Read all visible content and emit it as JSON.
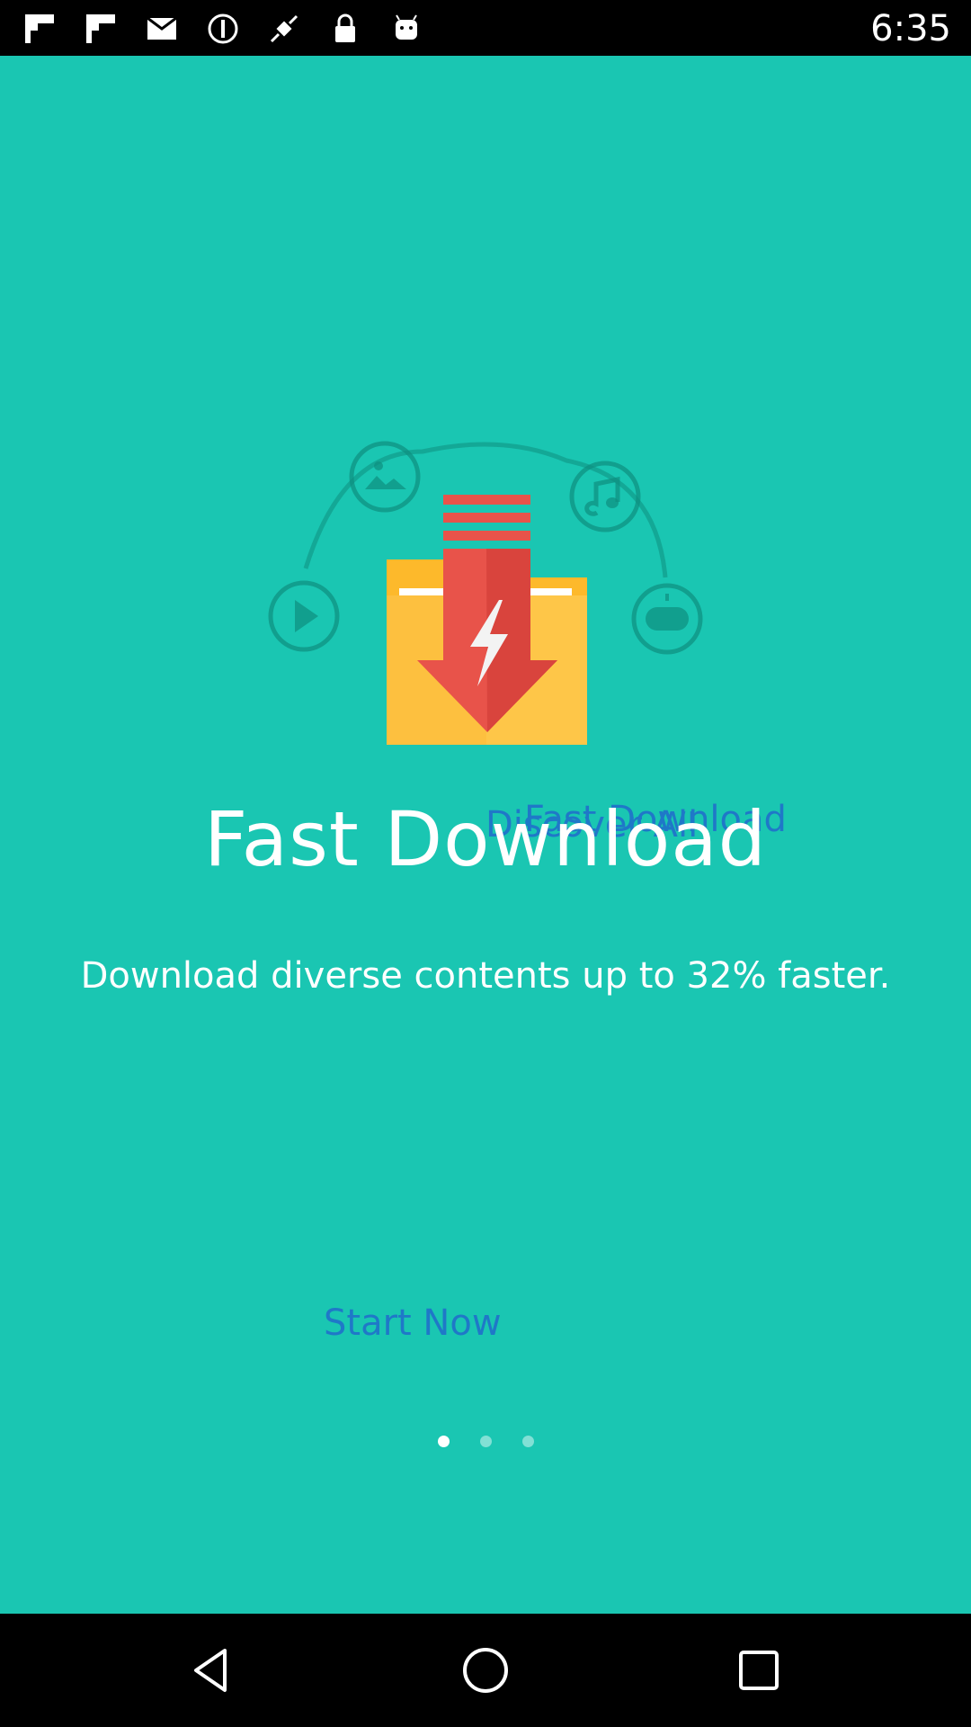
{
  "status_bar": {
    "time": "6:35",
    "icons": [
      "flipboard-icon",
      "flipboard-icon",
      "mail-icon",
      "circle-info-icon",
      "fake-gps-icon",
      "lock-icon",
      "android-icon"
    ]
  },
  "onboarding": {
    "overlay_labels": [
      "Fast Download",
      "Discover All"
    ],
    "title": "Fast Download",
    "subtitle": "Download diverse contents up to 32% faster.",
    "start_button": "Start Now",
    "pager": {
      "pages": 3,
      "current": 1
    }
  },
  "colors": {
    "background": "#1AC6B2",
    "accent_text": "#1F78C8",
    "folder": "#FDB92B",
    "arrow": "#E8534A"
  },
  "nav_bar": {
    "icons": [
      "back-icon",
      "home-icon",
      "recent-apps-icon"
    ]
  }
}
